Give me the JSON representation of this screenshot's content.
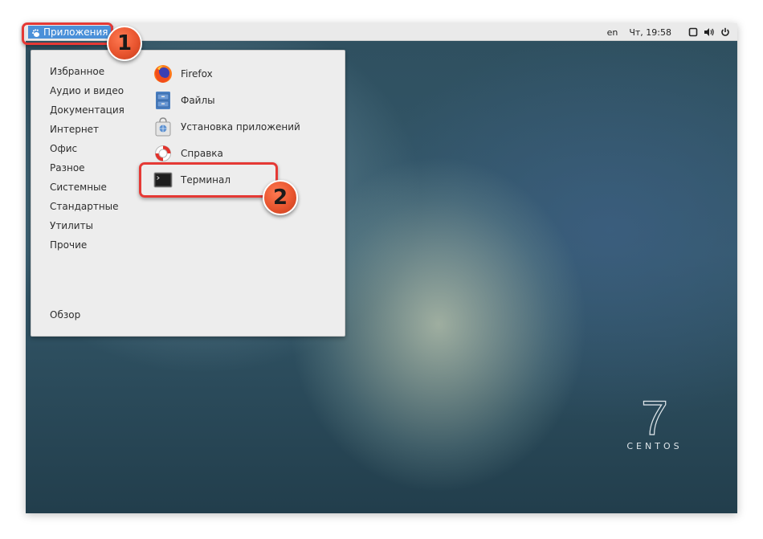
{
  "topbar": {
    "apps_label": "Приложения",
    "language": "en",
    "clock": "Чт, 19:58",
    "icons": [
      "screen-icon",
      "volume-icon",
      "power-icon"
    ]
  },
  "menu": {
    "categories": [
      {
        "label": "Избранное"
      },
      {
        "label": "Аудио и видео"
      },
      {
        "label": "Документация"
      },
      {
        "label": "Интернет"
      },
      {
        "label": "Офис"
      },
      {
        "label": "Разное"
      },
      {
        "label": "Системные"
      },
      {
        "label": "Стандартные"
      },
      {
        "label": "Утилиты"
      },
      {
        "label": "Прочие"
      }
    ],
    "overview_label": "Обзор",
    "apps": [
      {
        "label": "Firefox",
        "icon": "firefox-icon"
      },
      {
        "label": "Файлы",
        "icon": "files-icon"
      },
      {
        "label": "Установка приложений",
        "icon": "software-install-icon"
      },
      {
        "label": "Справка",
        "icon": "help-lifebuoy-icon"
      },
      {
        "label": "Терминал",
        "icon": "terminal-icon"
      }
    ]
  },
  "annotations": {
    "badge1": "1",
    "badge2": "2",
    "highlight_color": "#e53935"
  },
  "branding": {
    "version": "7",
    "name": "CENTOS"
  },
  "colors": {
    "accent": "#4a90d9",
    "badge": "#e8552f"
  }
}
